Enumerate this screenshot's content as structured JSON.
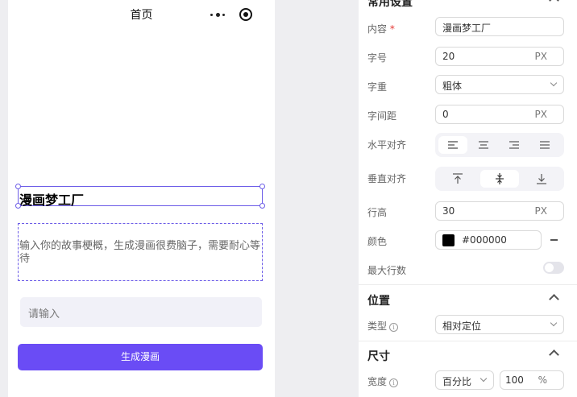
{
  "preview": {
    "page_title": "首页",
    "heading": "漫画梦工厂",
    "description": "输入你的故事梗概，生成漫画很费脑子，需要耐心等待",
    "input_placeholder": "请输入",
    "generate_button": "生成漫画"
  },
  "panel": {
    "common_section": "常用设置",
    "content_label": "内容",
    "required_mark": "*",
    "content_value": "漫画梦工厂",
    "font_size_label": "字号",
    "font_size_value": "20",
    "font_size_unit": "PX",
    "font_weight_label": "字重",
    "font_weight_value": "粗体",
    "letter_spacing_label": "字间距",
    "letter_spacing_value": "0",
    "letter_spacing_unit": "PX",
    "h_align_label": "水平对齐",
    "v_align_label": "垂直对齐",
    "line_height_label": "行高",
    "line_height_value": "30",
    "line_height_unit": "PX",
    "color_label": "颜色",
    "color_value": "#000000",
    "max_lines_label": "最大行数",
    "position_section": "位置",
    "type_label": "类型",
    "type_value": "相对定位",
    "size_section": "尺寸",
    "width_label": "宽度",
    "width_mode": "百分比",
    "width_value": "100",
    "width_unit": "%"
  },
  "colors": {
    "accent": "#6a4cf5",
    "selection": "#6c5ce7",
    "text_color": "#000000"
  }
}
